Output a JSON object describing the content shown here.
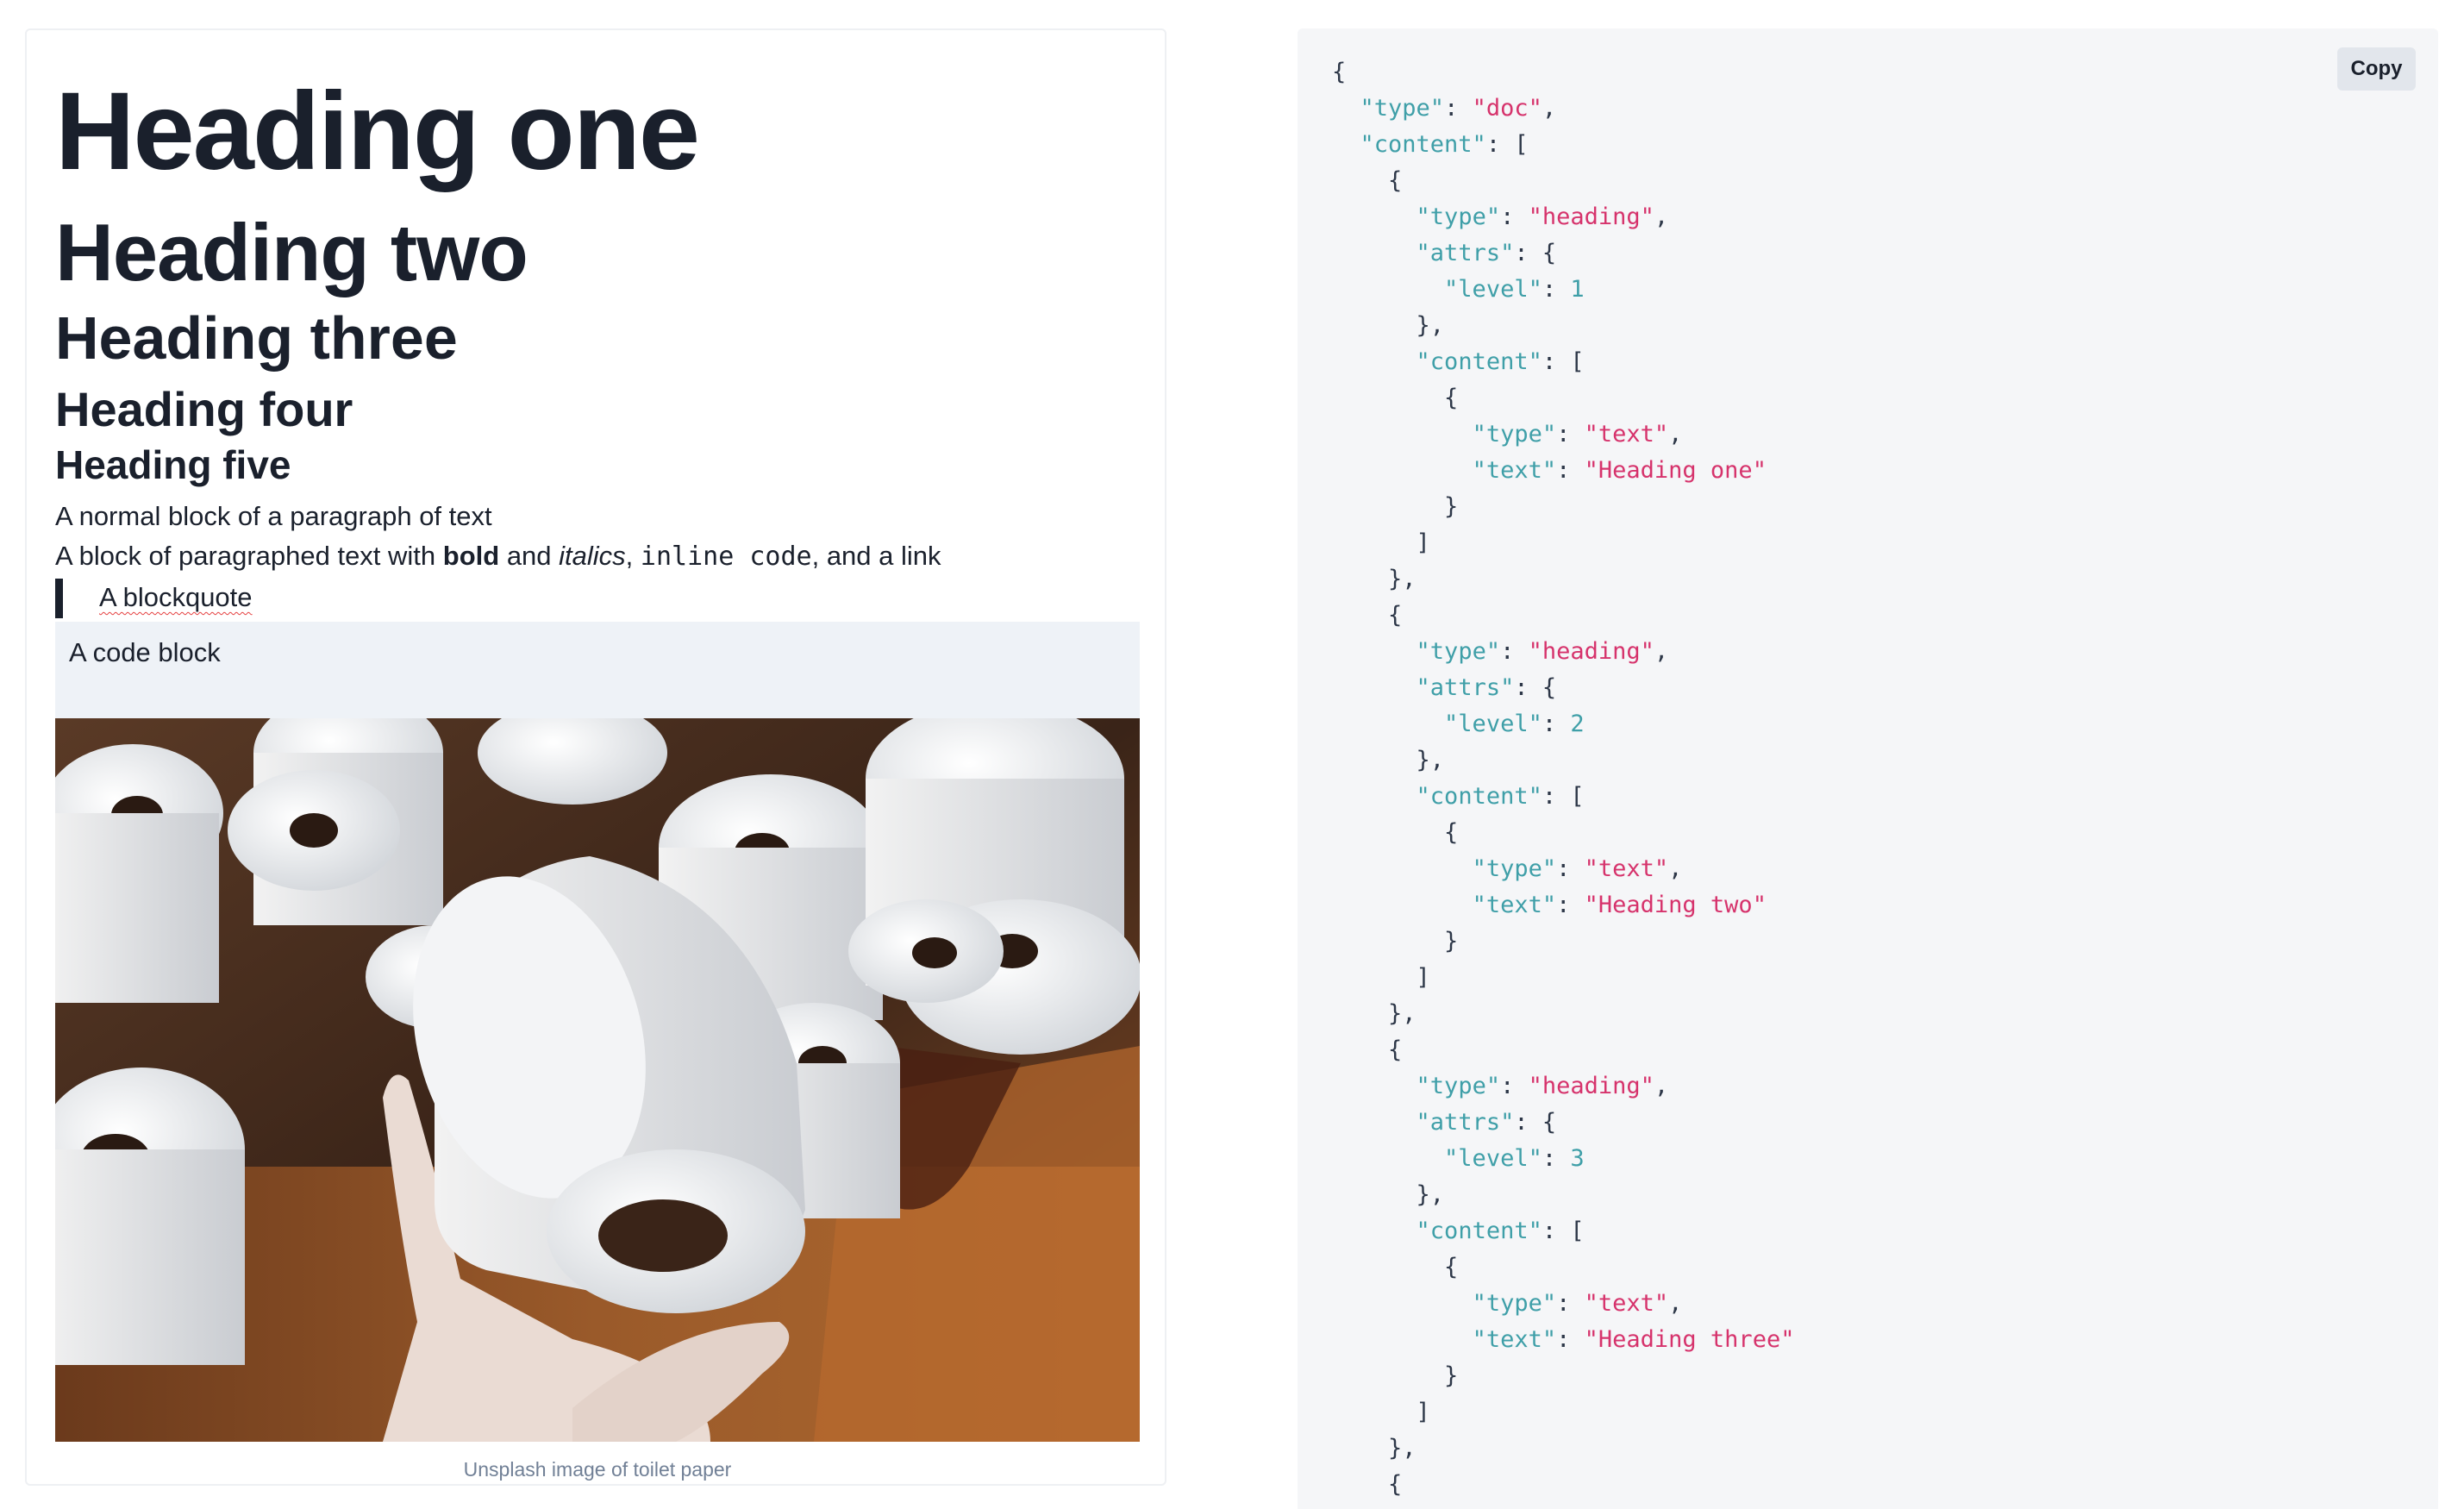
{
  "editor": {
    "heading1": "Heading one",
    "heading2": "Heading two",
    "heading3": "Heading three",
    "heading4": "Heading four",
    "heading5": "Heading five",
    "paragraph1": "A normal block of a paragraph of text",
    "paragraph2": {
      "prefix": "A block of paragraphed text with ",
      "bold": "bold",
      "mid1": " and ",
      "italic": "italics",
      "mid2": ", ",
      "code": "inline code",
      "mid3": ", and a link"
    },
    "blockquote": "A blockquote",
    "codeblock": "A code block",
    "image_caption": "Unsplash image of toilet paper"
  },
  "json_panel": {
    "copy_label": "Copy",
    "lines": [
      [
        [
          "p",
          "{"
        ]
      ],
      [
        [
          "p",
          "  "
        ],
        [
          "k",
          "\"type\""
        ],
        [
          "p",
          ": "
        ],
        [
          "s",
          "\"doc\""
        ],
        [
          "p",
          ","
        ]
      ],
      [
        [
          "p",
          "  "
        ],
        [
          "k",
          "\"content\""
        ],
        [
          "p",
          ": ["
        ]
      ],
      [
        [
          "p",
          "    {"
        ]
      ],
      [
        [
          "p",
          "      "
        ],
        [
          "k",
          "\"type\""
        ],
        [
          "p",
          ": "
        ],
        [
          "s",
          "\"heading\""
        ],
        [
          "p",
          ","
        ]
      ],
      [
        [
          "p",
          "      "
        ],
        [
          "k",
          "\"attrs\""
        ],
        [
          "p",
          ": {"
        ]
      ],
      [
        [
          "p",
          "        "
        ],
        [
          "k",
          "\"level\""
        ],
        [
          "p",
          ": "
        ],
        [
          "n",
          "1"
        ]
      ],
      [
        [
          "p",
          "      },"
        ]
      ],
      [
        [
          "p",
          "      "
        ],
        [
          "k",
          "\"content\""
        ],
        [
          "p",
          ": ["
        ]
      ],
      [
        [
          "p",
          "        {"
        ]
      ],
      [
        [
          "p",
          "          "
        ],
        [
          "k",
          "\"type\""
        ],
        [
          "p",
          ": "
        ],
        [
          "s",
          "\"text\""
        ],
        [
          "p",
          ","
        ]
      ],
      [
        [
          "p",
          "          "
        ],
        [
          "k",
          "\"text\""
        ],
        [
          "p",
          ": "
        ],
        [
          "s",
          "\"Heading one\""
        ]
      ],
      [
        [
          "p",
          "        }"
        ]
      ],
      [
        [
          "p",
          "      ]"
        ]
      ],
      [
        [
          "p",
          "    },"
        ]
      ],
      [
        [
          "p",
          "    {"
        ]
      ],
      [
        [
          "p",
          "      "
        ],
        [
          "k",
          "\"type\""
        ],
        [
          "p",
          ": "
        ],
        [
          "s",
          "\"heading\""
        ],
        [
          "p",
          ","
        ]
      ],
      [
        [
          "p",
          "      "
        ],
        [
          "k",
          "\"attrs\""
        ],
        [
          "p",
          ": {"
        ]
      ],
      [
        [
          "p",
          "        "
        ],
        [
          "k",
          "\"level\""
        ],
        [
          "p",
          ": "
        ],
        [
          "n",
          "2"
        ]
      ],
      [
        [
          "p",
          "      },"
        ]
      ],
      [
        [
          "p",
          "      "
        ],
        [
          "k",
          "\"content\""
        ],
        [
          "p",
          ": ["
        ]
      ],
      [
        [
          "p",
          "        {"
        ]
      ],
      [
        [
          "p",
          "          "
        ],
        [
          "k",
          "\"type\""
        ],
        [
          "p",
          ": "
        ],
        [
          "s",
          "\"text\""
        ],
        [
          "p",
          ","
        ]
      ],
      [
        [
          "p",
          "          "
        ],
        [
          "k",
          "\"text\""
        ],
        [
          "p",
          ": "
        ],
        [
          "s",
          "\"Heading two\""
        ]
      ],
      [
        [
          "p",
          "        }"
        ]
      ],
      [
        [
          "p",
          "      ]"
        ]
      ],
      [
        [
          "p",
          "    },"
        ]
      ],
      [
        [
          "p",
          "    {"
        ]
      ],
      [
        [
          "p",
          "      "
        ],
        [
          "k",
          "\"type\""
        ],
        [
          "p",
          ": "
        ],
        [
          "s",
          "\"heading\""
        ],
        [
          "p",
          ","
        ]
      ],
      [
        [
          "p",
          "      "
        ],
        [
          "k",
          "\"attrs\""
        ],
        [
          "p",
          ": {"
        ]
      ],
      [
        [
          "p",
          "        "
        ],
        [
          "k",
          "\"level\""
        ],
        [
          "p",
          ": "
        ],
        [
          "n",
          "3"
        ]
      ],
      [
        [
          "p",
          "      },"
        ]
      ],
      [
        [
          "p",
          "      "
        ],
        [
          "k",
          "\"content\""
        ],
        [
          "p",
          ": ["
        ]
      ],
      [
        [
          "p",
          "        {"
        ]
      ],
      [
        [
          "p",
          "          "
        ],
        [
          "k",
          "\"type\""
        ],
        [
          "p",
          ": "
        ],
        [
          "s",
          "\"text\""
        ],
        [
          "p",
          ","
        ]
      ],
      [
        [
          "p",
          "          "
        ],
        [
          "k",
          "\"text\""
        ],
        [
          "p",
          ": "
        ],
        [
          "s",
          "\"Heading three\""
        ]
      ],
      [
        [
          "p",
          "        }"
        ]
      ],
      [
        [
          "p",
          "      ]"
        ]
      ],
      [
        [
          "p",
          "    },"
        ]
      ],
      [
        [
          "p",
          "    {"
        ]
      ]
    ]
  }
}
